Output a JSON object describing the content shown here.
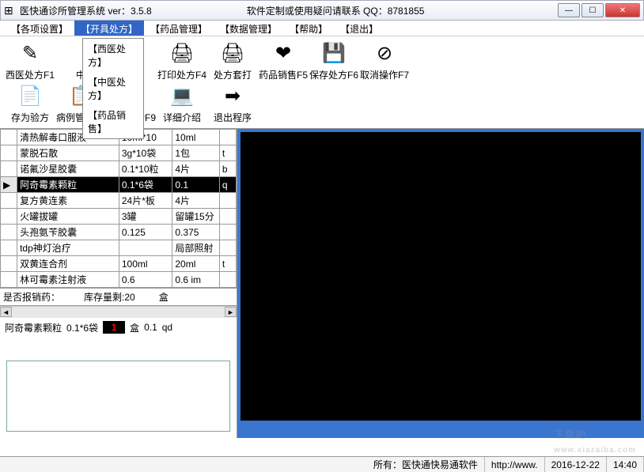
{
  "window": {
    "title": "医快通诊所管理系统  ver：3.5.8",
    "subtitle": "软件定制或使用疑问请联系  QQ：8781855"
  },
  "menu": {
    "items": [
      "【各项设置】",
      "【开具处方】",
      "【药品管理】",
      "【数据管理】",
      "【帮助】",
      "【退出】"
    ],
    "selected_index": 1
  },
  "dropdown": {
    "items": [
      "【西医处方】",
      "【中医处方】",
      "【药品销售】"
    ]
  },
  "toolbar_row1": [
    {
      "label": "西医处方F1",
      "icon": "✎"
    },
    {
      "label": "中",
      "icon": ""
    },
    {
      "label": "",
      "icon": ""
    },
    {
      "label": "打印处方F4",
      "icon": "🖨"
    },
    {
      "label": "处方套打",
      "icon": "🖨"
    },
    {
      "label": "药品销售F5",
      "icon": "❤"
    },
    {
      "label": "保存处方F6",
      "icon": "💾"
    },
    {
      "label": "取消操作F7",
      "icon": "⊘"
    }
  ],
  "toolbar_row2": [
    {
      "label": "存为验方",
      "icon": "📄"
    },
    {
      "label": "病例管理F8",
      "icon": "📋"
    },
    {
      "label": "数据统计F9",
      "icon": "📊"
    },
    {
      "label": "详细介绍",
      "icon": "💻"
    },
    {
      "label": "退出程序",
      "icon": "➡"
    }
  ],
  "grid": {
    "rows": [
      {
        "marker": "",
        "name": "清热解毒口服液",
        "spec": "10ml*10",
        "dose": "10ml",
        "ext": ""
      },
      {
        "marker": "",
        "name": "蒙脱石散",
        "spec": "3g*10袋",
        "dose": "1包",
        "ext": "t"
      },
      {
        "marker": "",
        "name": "诺氟沙星胶囊",
        "spec": "0.1*10粒",
        "dose": "4片",
        "ext": "b"
      },
      {
        "marker": "▶",
        "name": "阿奇霉素颗粒",
        "spec": "0.1*6袋",
        "dose": "0.1",
        "ext": "q",
        "selected": true
      },
      {
        "marker": "",
        "name": "复方黄连素",
        "spec": "24片*板",
        "dose": "4片",
        "ext": ""
      },
      {
        "marker": "",
        "name": "火罐拔罐",
        "spec": "3罐",
        "dose": "留罐15分",
        "ext": ""
      },
      {
        "marker": "",
        "name": "头孢氨苄胶囊",
        "spec": "0.125",
        "dose": "0.375",
        "ext": ""
      },
      {
        "marker": "",
        "name": "tdp神灯治疗",
        "spec": "",
        "dose": "局部照射",
        "ext": ""
      },
      {
        "marker": "",
        "name": "双黄连合剂",
        "spec": "100ml",
        "dose": "20ml",
        "ext": "t"
      },
      {
        "marker": "",
        "name": "林可霉素注射液",
        "spec": "0.6",
        "dose": "0.6 im",
        "ext": ""
      }
    ]
  },
  "stock": {
    "q": "是否报销药：",
    "stock_label": "库存量剩:20",
    "unit": "盒"
  },
  "edit": {
    "name": "阿奇霉素颗粒",
    "spec": "0.1*6袋",
    "qty": "1",
    "unit": "盒",
    "dose": "0.1",
    "freq": "qd"
  },
  "status": {
    "owner": "所有：医快通快易通软件",
    "url": "http://www.",
    "date": "2016-12-22",
    "time": "14:40"
  },
  "watermark": {
    "big": "下载吧",
    "small": "www.xiazaiba.com"
  }
}
